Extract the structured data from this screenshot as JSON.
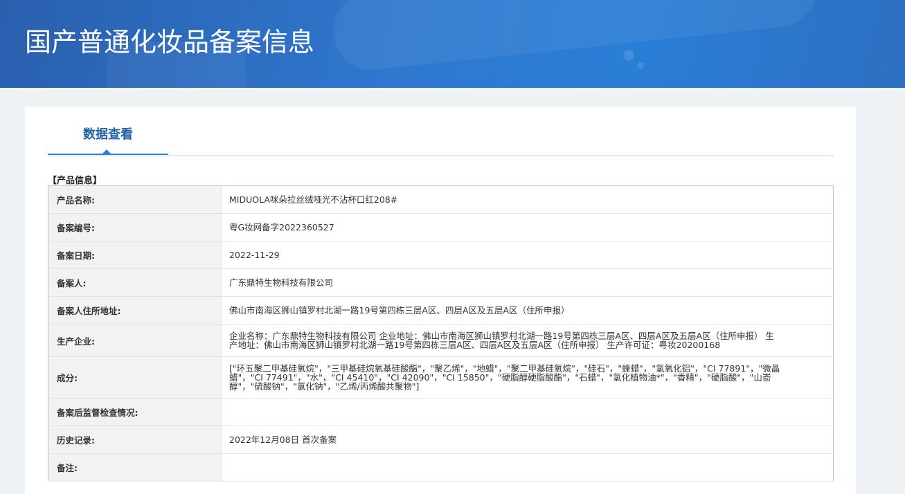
{
  "header": {
    "title": "国产普通化妆品备案信息"
  },
  "tab": {
    "label": "数据查看"
  },
  "section_title": "【产品信息】",
  "rows": [
    {
      "label": "产品名称:",
      "value": "MIDUOLA咪朵拉丝绒哑光不沾杯口红208#"
    },
    {
      "label": "备案编号:",
      "value": "粤G妆网备字2022360527"
    },
    {
      "label": "备案日期:",
      "value": "2022-11-29"
    },
    {
      "label": "备案人:",
      "value": "广东鼎特生物科技有限公司"
    },
    {
      "label": "备案人住所地址:",
      "value": "佛山市南海区狮山镇罗村北湖一路19号第四栋三层A区、四层A区及五层A区（住所申报）"
    },
    {
      "label": "生产企业:",
      "value": "企业名称：广东鼎特生物科技有限公司 企业地址：佛山市南海区狮山镇罗村北湖一路19号第四栋三层A区、四层A区及五层A区（住所申报） 生产地址：佛山市南海区狮山镇罗村北湖一路19号第四栋三层A区、四层A区及五层A区（住所申报） 生产许可证：粤妆20200168"
    },
    {
      "label": "成分:",
      "value": "[\"环五聚二甲基硅氧烷\"，\"三甲基硅烷氧基硅酸酯\"，\"聚乙烯\"，\"地蜡\"，\"聚二甲基硅氧烷\"，\"硅石\"，\"蜂蜡\"，\"氢氧化铝\"，\"CI 77891\"，\"微晶蜡\"，\"CI 77491\"，\"水\"，\"CI 45410\"，\"CI 42090\"，\"CI 15850\"，\"硬脂醇硬脂酸酯\"，\"石蜡\"，\"氢化植物油*\"，\"香精\"，\"硬脂酸\"，\"山嵛醇\"，\"硫酸钠\"，\"氯化钠\"，\"乙烯/丙烯酸共聚物\"]"
    },
    {
      "label": "备案后监督检查情况:",
      "value": ""
    },
    {
      "label": "历史记录:",
      "value": "2022年12月08日 首次备案"
    },
    {
      "label": "备注:",
      "value": ""
    }
  ]
}
